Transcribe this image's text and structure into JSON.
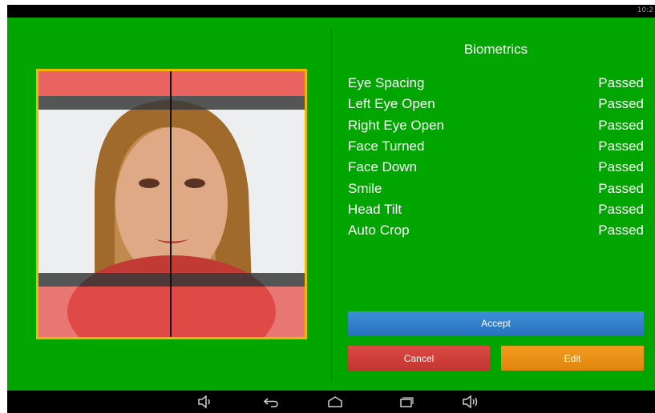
{
  "status_bar": {
    "time": "10:2"
  },
  "biometrics": {
    "title": "Biometrics",
    "checks": [
      {
        "label": "Eye Spacing",
        "status": "Passed"
      },
      {
        "label": "Left Eye Open",
        "status": "Passed"
      },
      {
        "label": "Right Eye Open",
        "status": "Passed"
      },
      {
        "label": "Face Turned",
        "status": "Passed"
      },
      {
        "label": "Face Down",
        "status": "Passed"
      },
      {
        "label": "Smile",
        "status": "Passed"
      },
      {
        "label": "Head Tilt",
        "status": "Passed"
      },
      {
        "label": "Auto Crop",
        "status": "Passed"
      }
    ]
  },
  "buttons": {
    "accept": "Accept",
    "cancel": "Cancel",
    "edit": "Edit"
  },
  "nav_bar": {
    "icons": [
      "volume-down-icon",
      "back-icon",
      "home-icon",
      "recent-apps-icon",
      "volume-up-icon"
    ]
  },
  "colors": {
    "background": "#00a500",
    "frame": "#f2b600",
    "accept": "#2f7fcb",
    "cancel": "#d0403b",
    "edit": "#ee9216",
    "overlay_red": "#e8504c"
  }
}
